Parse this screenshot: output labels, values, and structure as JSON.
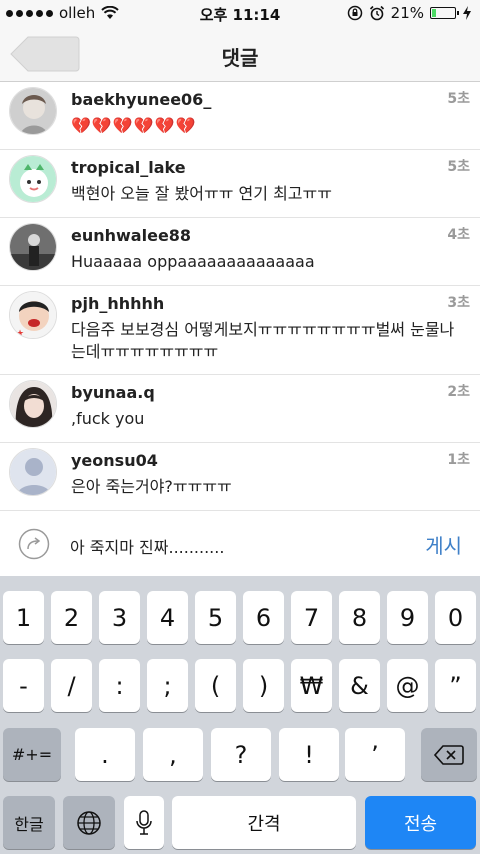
{
  "status_bar": {
    "carrier": "olleh",
    "time": "오후 11:14",
    "battery_pct": "21%",
    "battery_level": 0.21
  },
  "nav": {
    "title": "댓글"
  },
  "comments": [
    {
      "user": "baekhyunee06_",
      "text": "💔💔💔💔💔💔",
      "time": "5초"
    },
    {
      "user": "tropical_lake",
      "text": "백현아 오늘 잘 봤어ㅠㅠ 연기 최고ㅠㅠ",
      "time": "5초"
    },
    {
      "user": "eunhwalee88",
      "text": "Huaaaaa oppaaaaaaaaaaaaaa",
      "time": "4초"
    },
    {
      "user": "pjh_hhhhh",
      "text": "다음주 보보경심 어떻게보지ㅠㅠㅠㅠㅠㅠㅠㅠ벌써 눈물나는데ㅠㅠㅠㅠㅠㅠㅠㅠ",
      "time": "3초"
    },
    {
      "user": "byunaa.q",
      "text": ",fuck you",
      "time": "2초"
    },
    {
      "user": "yeonsu04",
      "text": "은아 죽는거야?ㅠㅠㅠㅠ",
      "time": "1초"
    }
  ],
  "composer": {
    "value": "아 죽지마 진짜...........",
    "post_label": "게시"
  },
  "keyboard": {
    "row1": [
      "1",
      "2",
      "3",
      "4",
      "5",
      "6",
      "7",
      "8",
      "9",
      "0"
    ],
    "row2": [
      "-",
      "/",
      ":",
      ";",
      "(",
      ")",
      "₩",
      "&",
      "@",
      "”"
    ],
    "row3": [
      ".",
      ",",
      "?",
      "!",
      "’"
    ],
    "shift_label": "#+=",
    "lang_label": "한글",
    "space_label": "간격",
    "send_label": "전송"
  }
}
